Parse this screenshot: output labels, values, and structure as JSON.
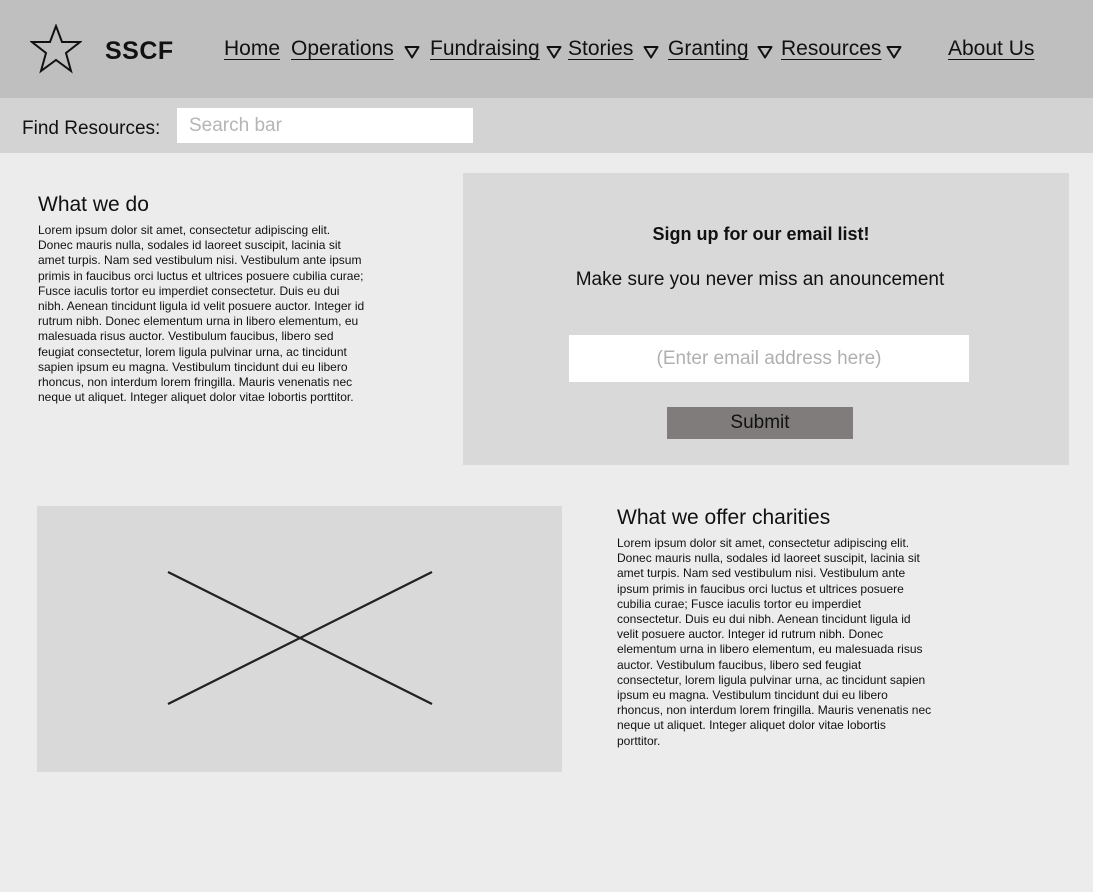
{
  "header": {
    "brand": "SSCF",
    "nav": [
      {
        "label": "Home"
      },
      {
        "label": "Operations"
      },
      {
        "label": "Fundraising"
      },
      {
        "label": "Stories"
      },
      {
        "label": "Granting"
      },
      {
        "label": "Resources"
      },
      {
        "label": "About Us"
      }
    ],
    "logo_icon": "star-icon",
    "caret_icon": "triangle-down-icon"
  },
  "find": {
    "label": "Find Resources:",
    "placeholder": "Search bar"
  },
  "what_we_do": {
    "title": "What we do",
    "lines": [
      "Lorem ipsum dolor sit amet, consectetur adipiscing elit.",
      "Donec mauris nulla, sodales id laoreet suscipit, lacinia sit",
      "amet turpis. Nam sed vestibulum nisi. Vestibulum ante ipsum",
      "primis in faucibus orci luctus et ultrices posuere cubilia curae;",
      "Fusce iaculis tortor eu imperdiet consectetur. Duis eu dui",
      "nibh. Aenean tincidunt ligula id velit posuere auctor. Integer id",
      "rutrum nibh. Donec elementum urna in libero elementum, eu",
      "malesuada risus auctor. Vestibulum faucibus, libero sed",
      "feugiat consectetur, lorem ligula pulvinar urna, ac tincidunt",
      "sapien ipsum eu magna. Vestibulum tincidunt dui eu libero",
      "rhoncus, non interdum lorem fringilla. Mauris venenatis nec",
      "neque ut aliquet. Integer aliquet dolor vitae lobortis porttitor."
    ]
  },
  "signup": {
    "title": "Sign up for our email list!",
    "subtitle": "Make sure you never miss an anouncement",
    "email_placeholder": "(Enter email address here)",
    "submit_label": "Submit"
  },
  "offer": {
    "title": "What we offer charities",
    "lines": [
      "Lorem ipsum dolor sit amet, consectetur adipiscing elit.",
      "Donec mauris nulla, sodales id laoreet suscipit, lacinia sit",
      "amet turpis. Nam sed vestibulum nisi. Vestibulum ante",
      "ipsum primis in faucibus orci luctus et ultrices posuere",
      "cubilia curae; Fusce iaculis tortor eu imperdiet",
      "consectetur. Duis eu dui nibh. Aenean tincidunt ligula id",
      "velit posuere auctor. Integer id rutrum nibh. Donec",
      "elementum urna in libero elementum, eu malesuada risus",
      "auctor. Vestibulum faucibus, libero sed feugiat",
      "consectetur, lorem ligula pulvinar urna, ac tincidunt sapien",
      "ipsum eu magna. Vestibulum tincidunt dui eu libero",
      "rhoncus, non interdum lorem fringilla. Mauris venenatis nec",
      "neque ut aliquet. Integer aliquet dolor vitae lobortis",
      "porttitor."
    ],
    "image_icon": "image-placeholder-icon"
  },
  "colors": {
    "header_bg": "#bfbfbf",
    "findbar_bg": "#d3d3d3",
    "page_bg": "#ececec",
    "panel_bg": "#d9d9d9",
    "button_bg": "#807c7c"
  }
}
